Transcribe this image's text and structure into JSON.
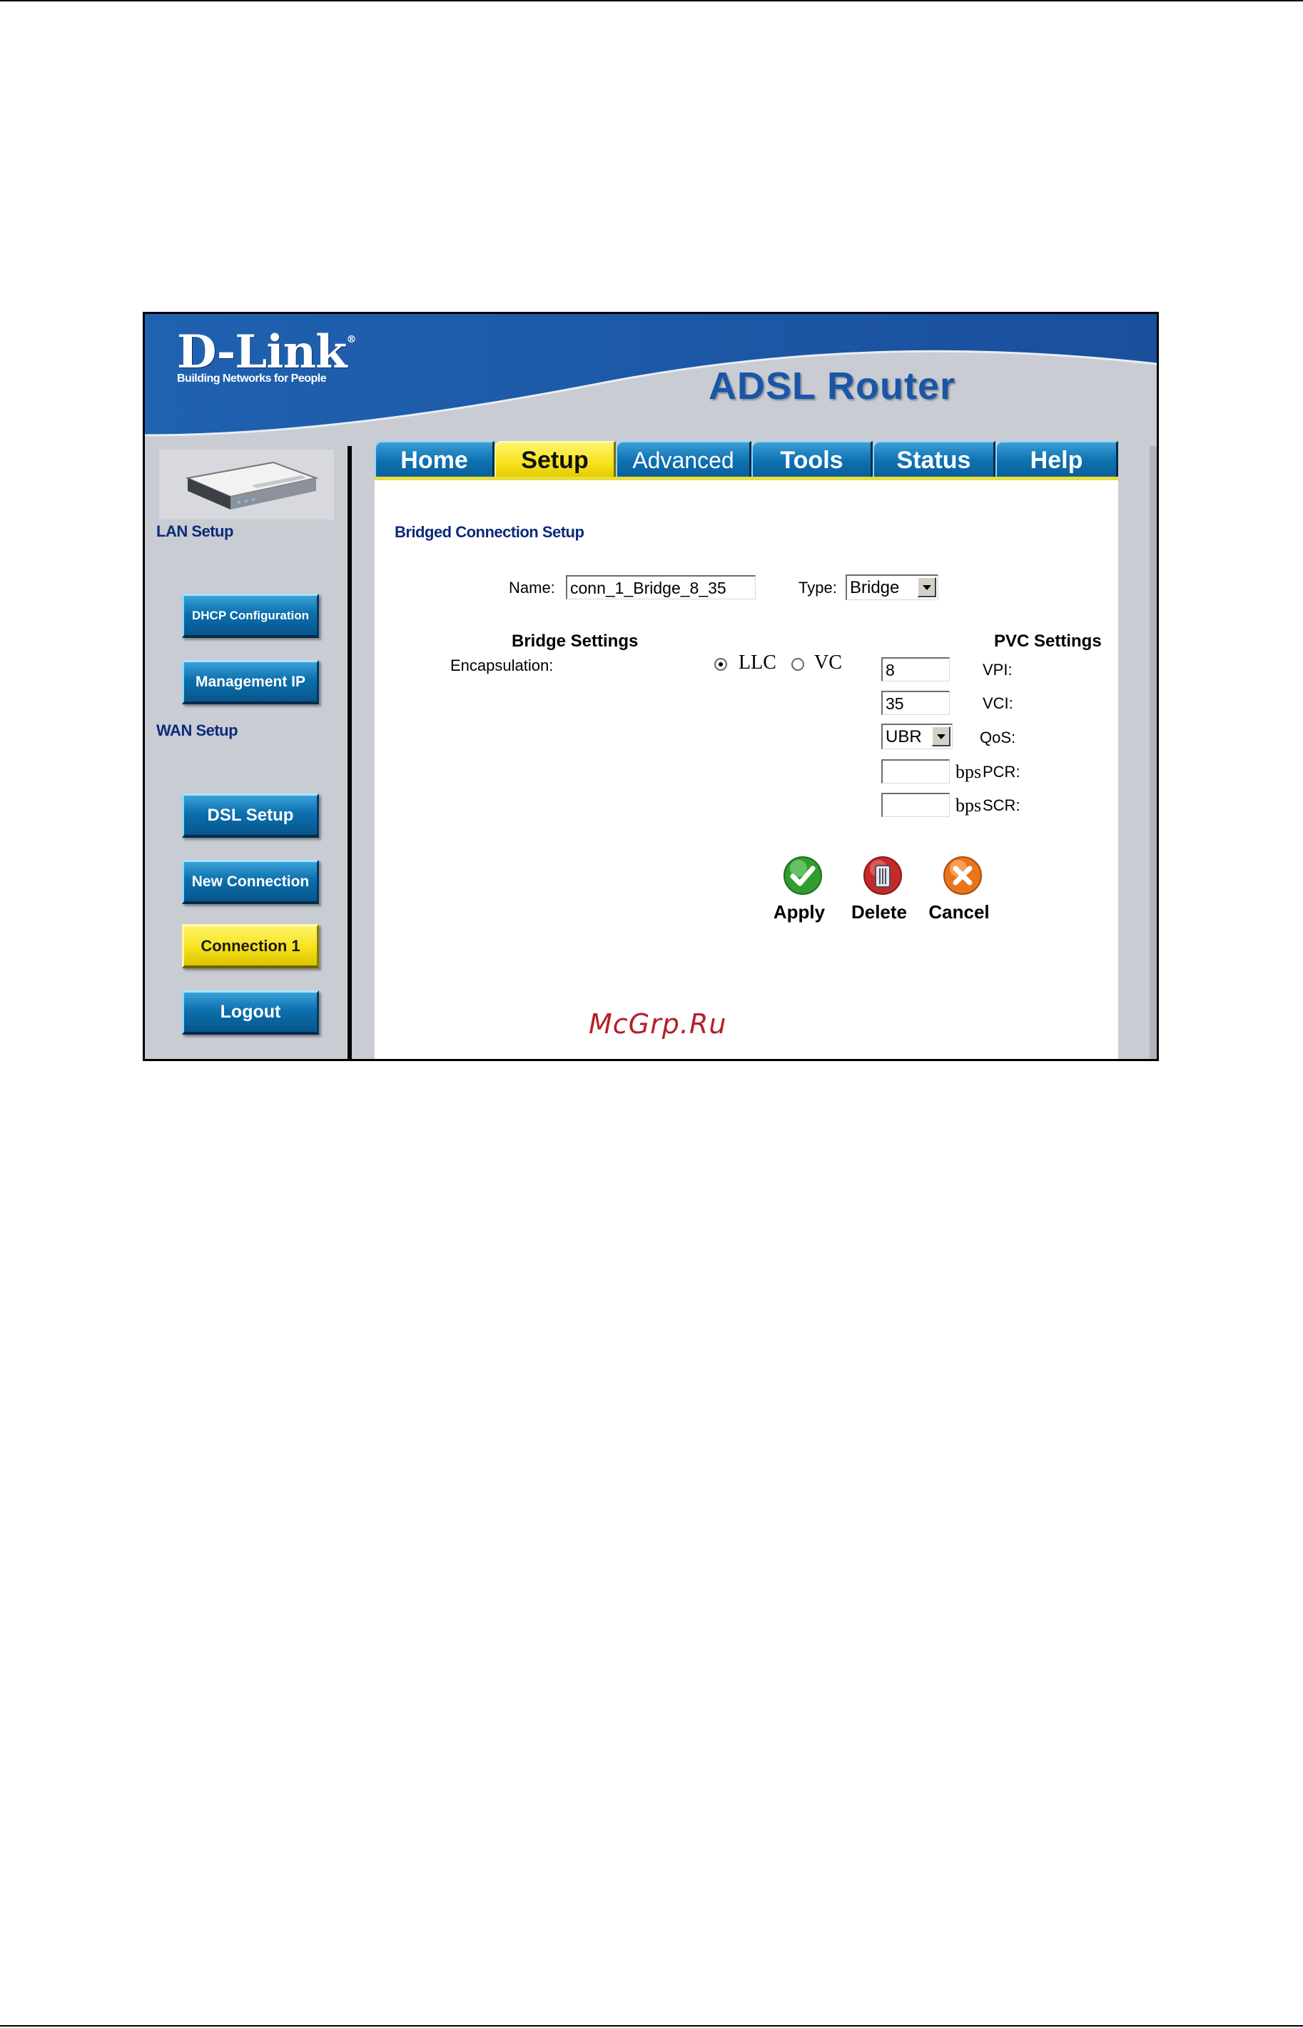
{
  "brand": {
    "logo_text": "D-Link",
    "tagline": "Building Networks for People",
    "product_name": "ADSL Router",
    "colors": {
      "banner_blue": "#1c5aa8",
      "tab_blue": "#0f72b3",
      "active_yellow": "#f7e21a",
      "nav_text": "#0b2a7a"
    }
  },
  "tabs": [
    {
      "label": "Home",
      "active": false
    },
    {
      "label": "Setup",
      "active": true
    },
    {
      "label": "Advanced",
      "active": false
    },
    {
      "label": "Tools",
      "active": false
    },
    {
      "label": "Status",
      "active": false
    },
    {
      "label": "Help",
      "active": false
    }
  ],
  "sidebar": {
    "lan_label": "LAN Setup",
    "wan_label": "WAN Setup",
    "buttons": {
      "dhcp": "DHCP Configuration",
      "mgmt": "Management IP",
      "dsl": "DSL Setup",
      "new_conn": "New Connection",
      "conn1": "Connection 1",
      "logout": "Logout"
    }
  },
  "form": {
    "title": "Bridged Connection Setup",
    "name_label": "Name:",
    "name_value": "conn_1_Bridge_8_35",
    "type_label": "Type:",
    "type_value": "Bridge",
    "bridge_heading": "Bridge Settings",
    "encapsulation_label": "Encapsulation:",
    "encap_options": [
      "LLC",
      "VC"
    ],
    "encap_selected": "LLC",
    "pvc_heading": "PVC Settings",
    "vpi_label": "VPI:",
    "vpi_value": "8",
    "vci_label": "VCI:",
    "vci_value": "35",
    "qos_label": "QoS:",
    "qos_value": "UBR",
    "pcr_label": "PCR:",
    "pcr_value": "",
    "scr_label": "SCR:",
    "scr_value": "",
    "unit": "bps"
  },
  "actions": {
    "apply": "Apply",
    "delete": "Delete",
    "cancel": "Cancel"
  },
  "watermark": "McGrp.Ru"
}
